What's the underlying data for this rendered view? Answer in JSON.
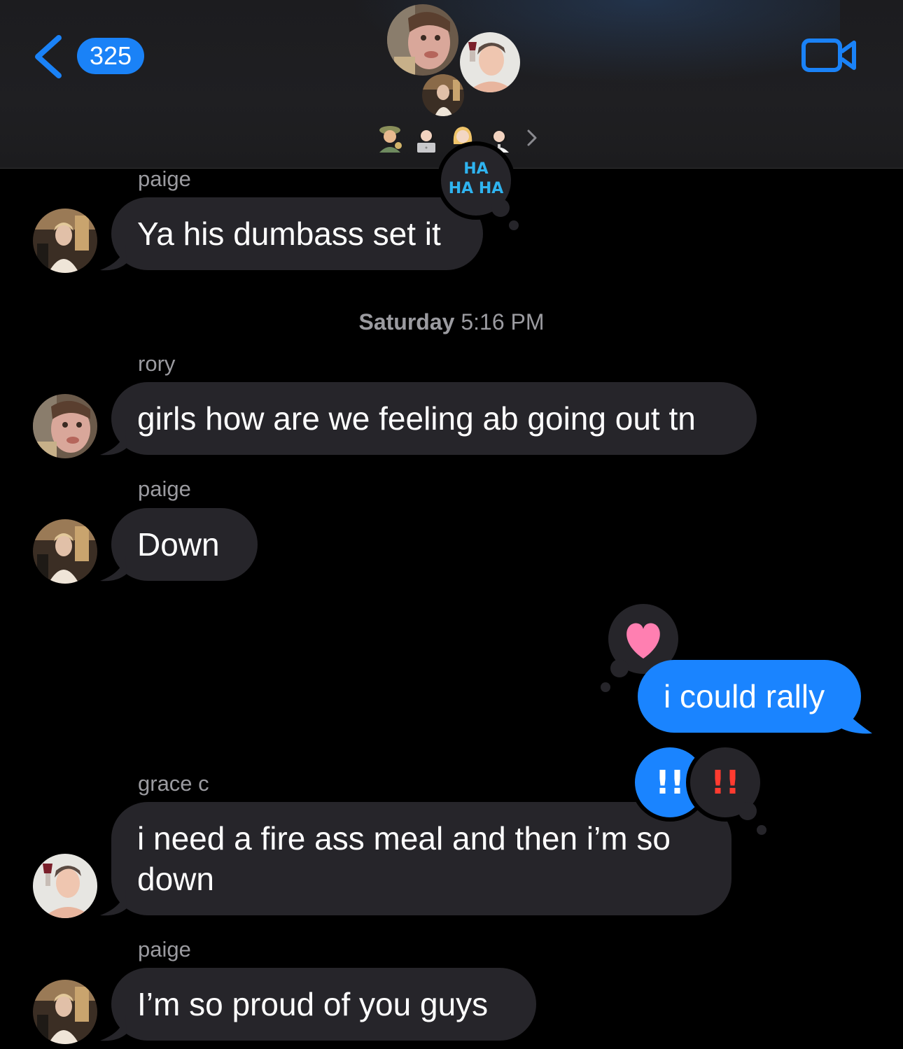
{
  "header": {
    "unread_count": "325",
    "back_label": "Back",
    "accent": "#1a82f7"
  },
  "timestamp": {
    "day": "Saturday",
    "time": "5:16 PM"
  },
  "messages": [
    {
      "sender": "paige",
      "text": "Ya his dumbass set it",
      "reaction": "HA HA"
    },
    {
      "sender": "rory",
      "text": "girls how are we feeling ab going out tn"
    },
    {
      "sender": "paige",
      "text": "Down"
    },
    {
      "sender": "me",
      "text": "i could rally",
      "reaction": "heart"
    },
    {
      "sender": "grace c",
      "text": "i need a fire ass meal and then i’m so down",
      "reactions": [
        "!!",
        "!!"
      ]
    },
    {
      "sender": "paige",
      "text": "I’m so proud of you guys"
    }
  ],
  "icons": {
    "back": "chevron-left-icon",
    "video": "video-camera-icon",
    "details": "chevron-right-icon"
  }
}
